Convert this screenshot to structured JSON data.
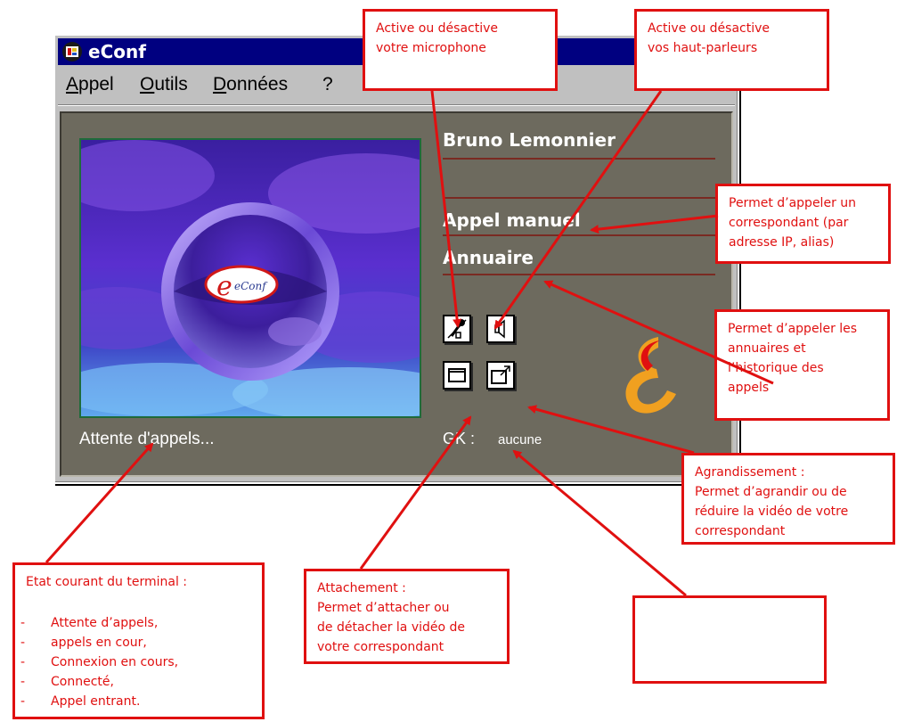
{
  "window": {
    "title": "eConf",
    "menu": [
      "Appel",
      "Outils",
      "Données",
      "?"
    ]
  },
  "panel": {
    "user_name": "Bruno Lemonnier",
    "manual_call": "Appel manuel",
    "directory": "Annuaire",
    "video_logo_text": "eConf",
    "status": "Attente d'appels...",
    "gk_label": "GK :",
    "gk_value": "aucune"
  },
  "icons": {
    "microphone": "microphone-icon",
    "speaker": "speaker-icon",
    "attach": "attach-window-icon",
    "enlarge": "enlarge-window-icon",
    "brand": "brand-logo-icon"
  },
  "callouts": {
    "microphone": "Active ou désactive\nvotre microphone",
    "speakers": "Active ou désactive\nvos haut-parleurs",
    "manual_call": "Permet d’appeler un\ncorrespondant (par\nadresse IP, alias)",
    "directory": "Permet d’appeler les\nannuaires et\nl’historique des\nappels",
    "enlarge": "Agrandissement :\nPermet d’agrandir ou de\nréduire la vidéo de votre\ncorrespondant",
    "attach": "Attachement :\nPermet d’attacher ou\nde détacher la vidéo de\nvotre correspondant",
    "terminal_state": {
      "title": "Etat courant du terminal :",
      "items": [
        "Attente d’appels,",
        "appels en cour,",
        "Connexion en cours,",
        "Connecté,",
        "Appel entrant."
      ]
    }
  },
  "colors": {
    "callout_red": "#e01010",
    "titlebar": "#000080",
    "panel": "#6d6a5e"
  }
}
